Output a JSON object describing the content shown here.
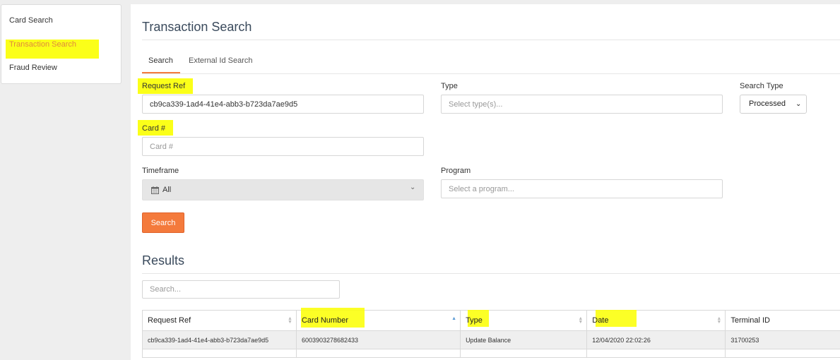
{
  "sidebar": {
    "items": [
      {
        "label": "Card Search"
      },
      {
        "label": "Transaction Search"
      },
      {
        "label": "Fraud Review"
      }
    ]
  },
  "page": {
    "title": "Transaction Search"
  },
  "tabs": [
    {
      "label": "Search"
    },
    {
      "label": "External Id Search"
    }
  ],
  "form": {
    "request_ref": {
      "label": "Request Ref",
      "value": "cb9ca339-1ad4-41e4-abb3-b723da7ae9d5"
    },
    "type": {
      "label": "Type",
      "placeholder": "Select type(s)..."
    },
    "search_type": {
      "label": "Search Type",
      "value": "Processed"
    },
    "card": {
      "label": "Card #",
      "placeholder": "Card #"
    },
    "timeframe": {
      "label": "Timeframe",
      "value": "All"
    },
    "program": {
      "label": "Program",
      "placeholder": "Select a program..."
    },
    "search_button": "Search"
  },
  "results": {
    "title": "Results",
    "search_placeholder": "Search...",
    "columns": [
      "Request Ref",
      "Card Number",
      "Type",
      "Date",
      "Terminal ID"
    ],
    "rows": [
      [
        "cb9ca339-1ad4-41e4-abb3-b723da7ae9d5",
        "6003903278682433",
        "Update Balance",
        "12/04/2020 22:02:26",
        "31700253"
      ]
    ]
  },
  "highlight_color": "#fbff00",
  "accent_color": "#f47a3c"
}
